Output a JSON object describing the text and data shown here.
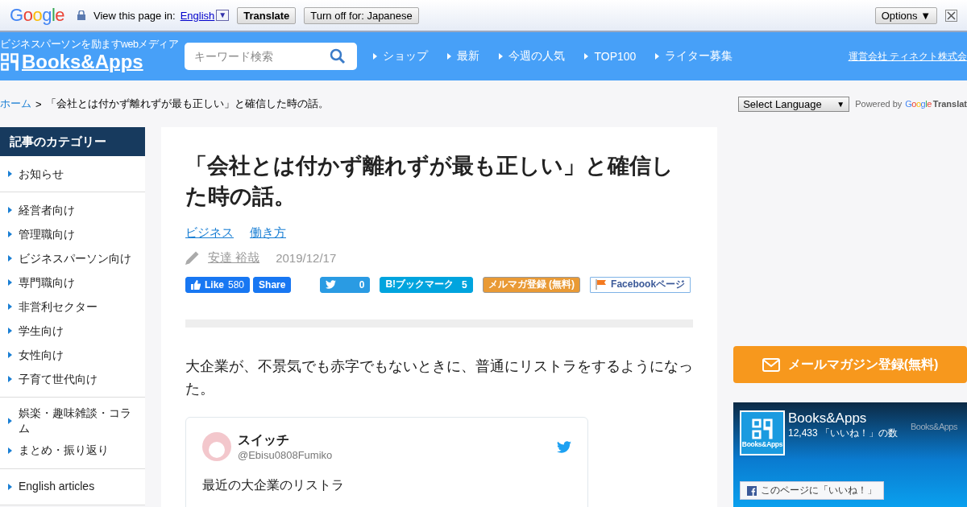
{
  "translate_bar": {
    "brand": "Google",
    "prompt": "View this page in:",
    "language": "English",
    "dropdown": "▼",
    "buttons": [
      "Translate",
      "Turn off for: Japanese"
    ],
    "options": "Options ▼"
  },
  "header": {
    "tagline": "ビジネスパーソンを励ますwebメディア",
    "logo": "Books&Apps",
    "search": {
      "placeholder": "キーワード検索"
    },
    "nav": [
      "ショップ",
      "最新",
      "今週の人気",
      "TOP100",
      "ライター募集"
    ],
    "company_link": "運営会社 ティネクト株式会"
  },
  "breadcrumb": {
    "home": "ホーム",
    "separator": ">",
    "current": "「会社とは付かず離れずが最も正しい」と確信した時の話。"
  },
  "language_select": {
    "value": "Select Language",
    "arrow": "▼",
    "powered_by": "Powered by",
    "brand": "Google",
    "product": "Translat"
  },
  "sidebar": {
    "title": "記事のカテゴリー",
    "groups": [
      {
        "items": [
          "お知らせ"
        ]
      },
      {
        "items": [
          "経営者向け",
          "管理職向け",
          "ビジネスパーソン向け",
          "専門職向け",
          "非営利セクター",
          "学生向け",
          "女性向け",
          "子育て世代向け"
        ]
      },
      {
        "items": [
          "娯楽・趣味雑談・コラム",
          "まとめ・振り返り"
        ]
      },
      {
        "items": [
          "English articles"
        ]
      }
    ]
  },
  "article": {
    "title": "「会社とは付かず離れずが最も正しい」と確信した時の話。",
    "tags": [
      "ビジネス",
      "働き方"
    ],
    "author": "安達 裕哉",
    "date": "2019/12/17",
    "share": [
      {
        "kind": "fb-like",
        "label": "Like",
        "count": "580"
      },
      {
        "kind": "fb-share",
        "label": "Share"
      },
      {
        "kind": "tweet",
        "count": "0"
      },
      {
        "kind": "hatena",
        "label": "B!ブックマーク",
        "count": "5"
      },
      {
        "kind": "mailmag",
        "label": "メルマガ登録 (無料)"
      },
      {
        "kind": "fb-page",
        "label": "Facebookページ"
      }
    ],
    "paragraph": "大企業が、不景気でも赤字でもないときに、普通にリストラをするようになった。",
    "tweet": {
      "name": "スイッチ",
      "handle": "@Ebisu0808Fumiko",
      "text": "最近の大企業のリストラ"
    }
  },
  "right": {
    "mail_button": "メールマガジン登録(無料)",
    "fb_widget": {
      "page": "Books&Apps",
      "likes": "12,433 「いいね！」の数",
      "logo_caption": "Books&Apps",
      "cover_text": "Books&Apps",
      "like_button": "このページに「いいね！」"
    }
  }
}
